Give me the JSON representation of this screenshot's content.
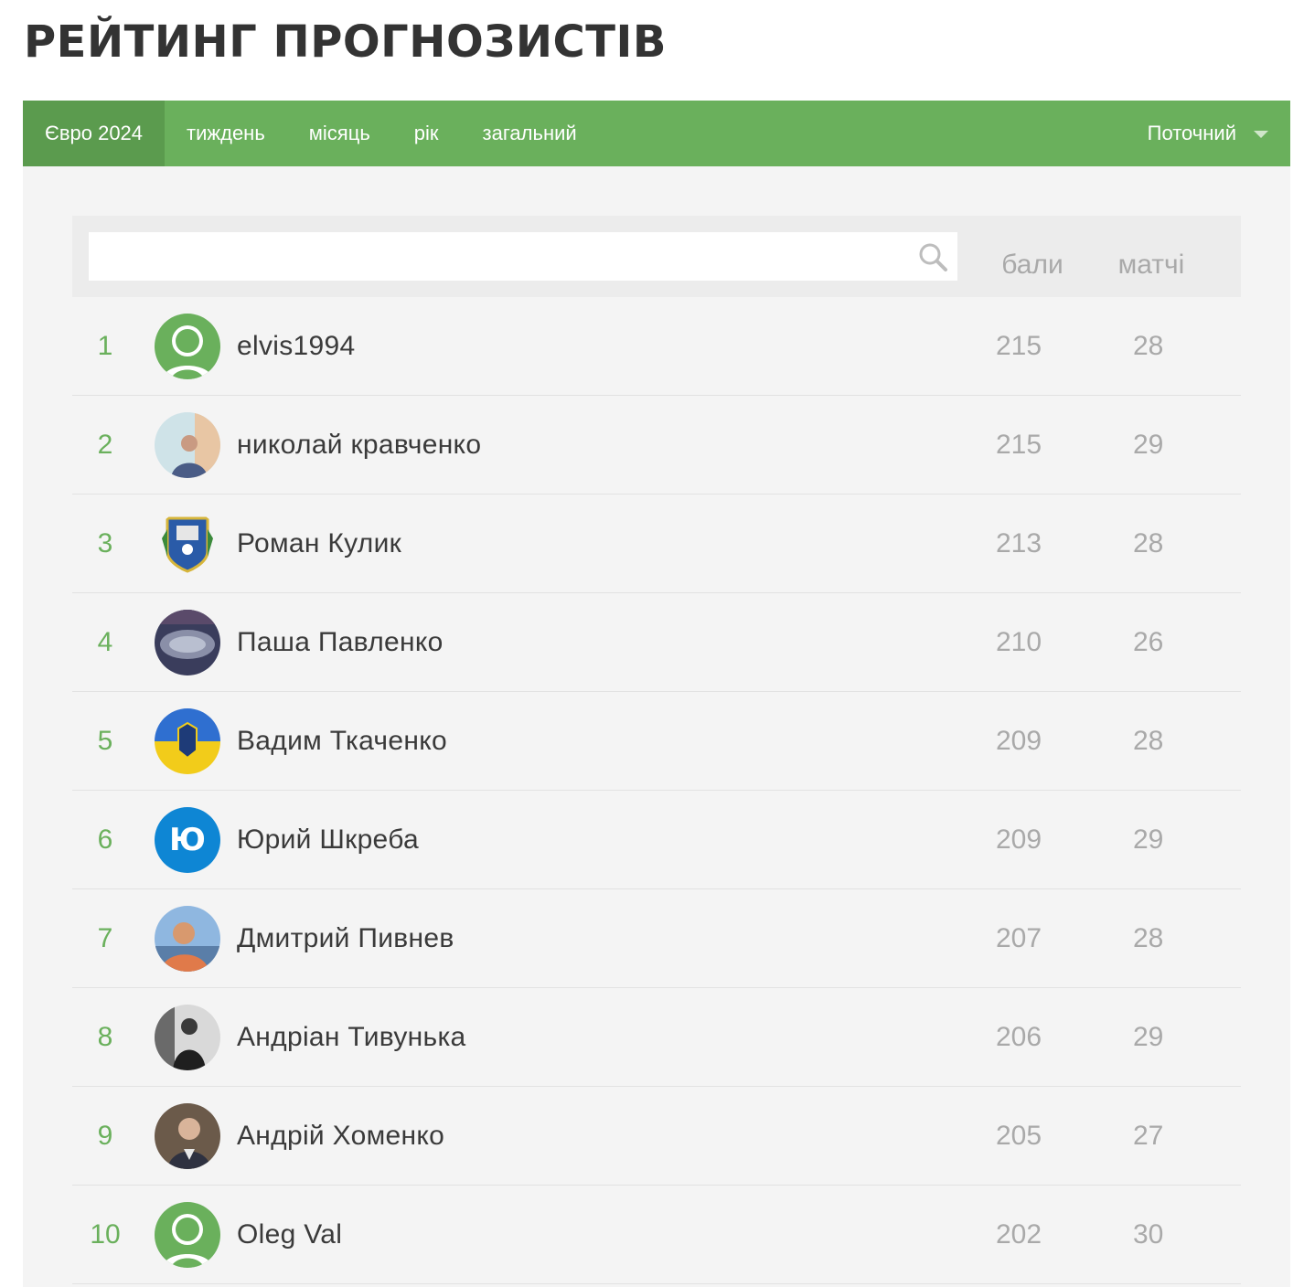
{
  "page": {
    "title": "РЕЙТИНГ ПРОГНОЗИСТІВ"
  },
  "tabs": [
    {
      "label": "Євро 2024",
      "active": true
    },
    {
      "label": "тиждень",
      "active": false
    },
    {
      "label": "місяць",
      "active": false
    },
    {
      "label": "рік",
      "active": false
    },
    {
      "label": "загальний",
      "active": false
    }
  ],
  "period_select": {
    "selected": "Поточний"
  },
  "search": {
    "value": "",
    "placeholder": ""
  },
  "columns": {
    "points": "бали",
    "matches": "матчі"
  },
  "colors": {
    "accent": "#6ab05c",
    "accent_dark": "#5b9b4e",
    "panel_bg": "#f4f4f4",
    "number_gray": "#a9a9a9",
    "letter_avatar": "#0e86d4"
  },
  "rows": [
    {
      "rank": "1",
      "name": "elvis1994",
      "points": "215",
      "matches": "28",
      "avatar": "default-user-icon"
    },
    {
      "rank": "2",
      "name": "николай кравченко",
      "points": "215",
      "matches": "29",
      "avatar": "photo"
    },
    {
      "rank": "3",
      "name": "Роман Кулик",
      "points": "213",
      "matches": "28",
      "avatar": "crest"
    },
    {
      "rank": "4",
      "name": "Паша Павленко",
      "points": "210",
      "matches": "26",
      "avatar": "stadium"
    },
    {
      "rank": "5",
      "name": "Вадим Ткаченко",
      "points": "209",
      "matches": "28",
      "avatar": "ukraine-flag"
    },
    {
      "rank": "6",
      "name": "Юрий Шкреба",
      "points": "209",
      "matches": "29",
      "avatar": "letter",
      "letter": "Ю"
    },
    {
      "rank": "7",
      "name": "Дмитрий Пивнев",
      "points": "207",
      "matches": "28",
      "avatar": "photo"
    },
    {
      "rank": "8",
      "name": "Андріан Тивунька",
      "points": "206",
      "matches": "29",
      "avatar": "photo-bw"
    },
    {
      "rank": "9",
      "name": "Андрій Хоменко",
      "points": "205",
      "matches": "27",
      "avatar": "photo"
    },
    {
      "rank": "10",
      "name": "Oleg Val",
      "points": "202",
      "matches": "30",
      "avatar": "default-user-icon"
    }
  ]
}
